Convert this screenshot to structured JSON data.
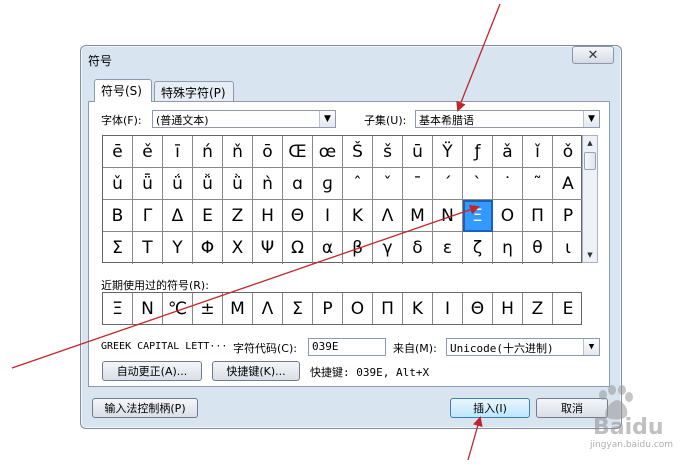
{
  "dialog": {
    "title": "符号",
    "close_label": "✕",
    "tabs": [
      {
        "label": "符号(S)",
        "active": true
      },
      {
        "label": "特殊字符(P)",
        "active": false
      }
    ],
    "font_label": "字体(F):",
    "font_value": "(普通文本)",
    "subset_label": "子集(U):",
    "subset_value": "基本希腊语",
    "symbol_rows": [
      [
        "ē",
        "ě",
        "ī",
        "ń",
        "ň",
        "ō",
        "Œ",
        "œ",
        "Š",
        "š",
        "ū",
        "Ÿ",
        "ƒ",
        "ǎ",
        "ǐ",
        "ǒ"
      ],
      [
        "ǔ",
        "ǖ",
        "ǘ",
        "ǚ",
        "ǜ",
        "ǹ",
        "ɑ",
        "ɡ",
        "ˆ",
        "ˇ",
        "ˉ",
        "ˊ",
        "ˋ",
        "˙",
        "˜",
        "Α"
      ],
      [
        "Β",
        "Γ",
        "Δ",
        "Ε",
        "Ζ",
        "Η",
        "Θ",
        "Ι",
        "Κ",
        "Λ",
        "Μ",
        "Ν",
        "Ξ",
        "Ο",
        "Π",
        "Ρ"
      ],
      [
        "Σ",
        "Τ",
        "Υ",
        "Φ",
        "Χ",
        "Ψ",
        "Ω",
        "α",
        "β",
        "γ",
        "δ",
        "ε",
        "ζ",
        "η",
        "θ",
        "ι"
      ]
    ],
    "selected_symbol": "Ξ",
    "recent_label": "近期使用过的符号(R):",
    "recent_symbols": [
      "Ξ",
      "Ν",
      "℃",
      "±",
      "Μ",
      "Λ",
      "Σ",
      "Ρ",
      "Ο",
      "Π",
      "Κ",
      "Ι",
      "Θ",
      "Η",
      "Ζ",
      "Ε"
    ],
    "char_name": "GREEK CAPITAL LETT···",
    "char_code_label": "字符代码(C):",
    "char_code_value": "039E",
    "from_label": "来自(M):",
    "from_value": "Unicode(十六进制)",
    "autocorrect_label": "自动更正(A)...",
    "shortcut_key_button_label": "快捷键(K)...",
    "shortcut_key_text": "快捷键: 039E, Alt+X",
    "ime_button_label": "输入法控制柄(P)",
    "insert_label": "插入(I)",
    "cancel_label": "取消"
  },
  "watermark": {
    "text": "Baidu",
    "sub": "jingyan.baidu.com"
  },
  "colors": {
    "dialog_bg": "#d9e4f1",
    "selection": "#3399ff",
    "arrow": "#c0262b"
  }
}
